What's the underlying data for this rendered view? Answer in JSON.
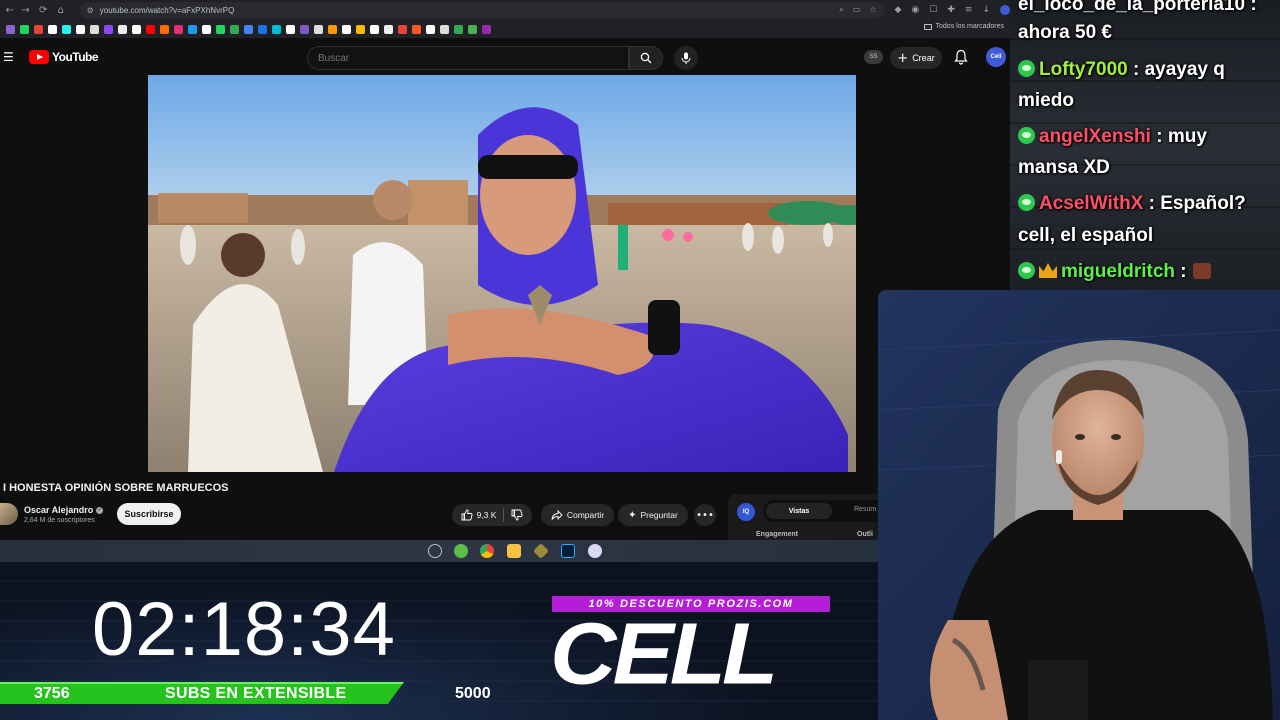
{
  "browser": {
    "url": "youtube.com/watch?v=aFxPXhNvrPQ",
    "bookmarks_folder_label": "Todos los marcadores"
  },
  "youtube": {
    "logo_text": "YouTube",
    "search_placeholder": "Buscar",
    "ss_badge": "SS",
    "create_label": "Crear",
    "avatar_label": "Cell",
    "video_title": "I HONESTA OPINIÓN SOBRE MARRUECOS",
    "channel_name": "Oscar Alejandro",
    "channel_subs": "2,64 M de suscriptores",
    "subscribe_label": "Suscribirse",
    "likes": "9,3 K",
    "share_label": "Compartir",
    "ask_label": "Preguntar",
    "panel": {
      "badge": "IQ",
      "tab_active": "Vistas",
      "tab_other": "Resum",
      "col1": "Engagement",
      "col2": "Outli"
    }
  },
  "overlay": {
    "timer": "02:18:34",
    "progress_start": "3756",
    "progress_label": "SUBS EN EXTENSIBLE",
    "progress_goal": "5000",
    "progress_fraction": 0.751,
    "promo": "10% DESCUENTO PROZIS.COM",
    "logo": "CELL"
  },
  "chat": [
    {
      "user": "el_loco_de_la_porteria10",
      "message": "ahora 50 €",
      "color": "#ffffff"
    },
    {
      "user": "Lofty7000",
      "message": "ayayay q miedo",
      "color": "#a4ef3a"
    },
    {
      "user": "angelXenshi",
      "message": "muy mansa XD",
      "color": "#ff4f67"
    },
    {
      "user": "AcselWithX",
      "message": "Español? cell, el español",
      "color": "#ff4f67"
    },
    {
      "user": "migueldritch",
      "message": "",
      "color": "#5ef04a"
    }
  ],
  "colors": {
    "youtube_red": "#ff0000",
    "progress_green": "#26c21d",
    "promo_purple": "#b41ed6",
    "chat_badge_green": "#2ec84e"
  }
}
